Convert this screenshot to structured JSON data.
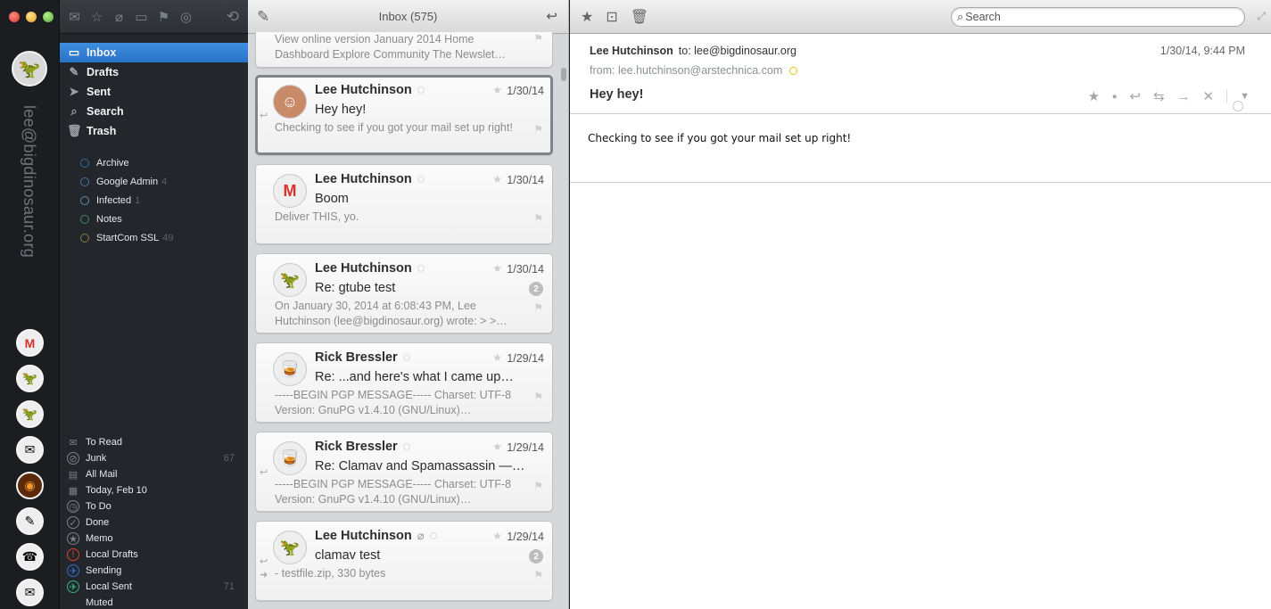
{
  "window": {
    "traffic_lights": [
      "close",
      "minimize",
      "zoom"
    ]
  },
  "rail": {
    "account_email": "lee@bigdinosaur.org",
    "avatars": [
      {
        "name": "gmail-avatar",
        "glyph": "M"
      },
      {
        "name": "dinosaur-avatar",
        "glyph": "🦖"
      },
      {
        "name": "dinosaur-avatar-2",
        "glyph": "🦖"
      },
      {
        "name": "envelope-avatar",
        "glyph": "✉"
      },
      {
        "name": "swirl-avatar",
        "glyph": "◉"
      },
      {
        "name": "admin-avatar",
        "glyph": "✎"
      },
      {
        "name": "webmaster-avatar",
        "glyph": "☎"
      },
      {
        "name": "envelope-avatar-2",
        "glyph": "✉"
      }
    ]
  },
  "sidebar": {
    "toolbar_icons": [
      "mail-icon",
      "star-icon",
      "paperclip-icon",
      "speech-icon",
      "flag-icon",
      "target-icon"
    ],
    "folders": [
      {
        "label": "Inbox",
        "icon": "tray-icon",
        "glyph": "▭",
        "active": true
      },
      {
        "label": "Drafts",
        "icon": "pencil-icon",
        "glyph": "✎",
        "active": false
      },
      {
        "label": "Sent",
        "icon": "paper-plane-icon",
        "glyph": "➤",
        "active": false
      },
      {
        "label": "Search",
        "icon": "search-icon",
        "glyph": "⌕",
        "active": false
      },
      {
        "label": "Trash",
        "icon": "trash-icon",
        "glyph": "🗑",
        "active": false
      }
    ],
    "labels": [
      {
        "label": "Archive",
        "count": "",
        "color": "#2a6fa8"
      },
      {
        "label": "Google Admin",
        "count": "4",
        "color": "#3d7aa0"
      },
      {
        "label": "Infected",
        "count": "1",
        "color": "#5e8fa8"
      },
      {
        "label": "Notes",
        "count": "",
        "color": "#3d8a5c"
      },
      {
        "label": "StartCom SSL",
        "count": "49",
        "color": "#8a7d40"
      }
    ],
    "smart_folders": [
      {
        "label": "To Read",
        "count": "",
        "icon": "envelope-icon",
        "glyph": "✉",
        "color": "#7c8189"
      },
      {
        "label": "Junk",
        "count": "67",
        "icon": "prohibited-icon",
        "glyph": "⊘",
        "color": "#7c8189"
      },
      {
        "label": "All Mail",
        "count": "",
        "icon": "archive-box-icon",
        "glyph": "▤",
        "color": "#7c8189"
      },
      {
        "label": "Today, Feb 10",
        "count": "",
        "icon": "book-icon",
        "glyph": "▦",
        "color": "#7c8189"
      },
      {
        "label": "To Do",
        "count": "",
        "icon": "clock-icon",
        "glyph": "◷",
        "color": "#7c8189"
      },
      {
        "label": "Done",
        "count": "",
        "icon": "checkmark-icon",
        "glyph": "✓",
        "color": "#7c8189"
      },
      {
        "label": "Memo",
        "count": "",
        "icon": "star-circle-icon",
        "glyph": "★",
        "color": "#7c8189"
      },
      {
        "label": "Local Drafts",
        "count": "",
        "icon": "warning-icon",
        "glyph": "!",
        "color": "#d9432e"
      },
      {
        "label": "Sending",
        "count": "",
        "icon": "plane-circle-icon",
        "glyph": "✈",
        "color": "#2d6fd0"
      },
      {
        "label": "Local Sent",
        "count": "71",
        "icon": "sent-circle-icon",
        "glyph": "✈",
        "color": "#2fb37a"
      },
      {
        "label": "Muted",
        "count": "",
        "icon": "",
        "glyph": "",
        "color": "#7c8189"
      }
    ]
  },
  "list": {
    "title": "Inbox (575)",
    "partial_preview": "View online version January 2014 Home Dashboard Explore Community The Newslet…",
    "messages": [
      {
        "from": "Lee Hutchinson",
        "subject": "Hey hey!",
        "date": "1/30/14",
        "preview": "Checking to see if you got your mail set up right!",
        "avatar": "person-photo",
        "glyph": "☺",
        "badge": "",
        "selected": true,
        "replied": true,
        "forwarded": false,
        "attachment": false
      },
      {
        "from": "Lee Hutchinson",
        "subject": "Boom",
        "date": "1/30/14",
        "preview": "Deliver THIS, yo.",
        "avatar": "gmail-logo",
        "glyph": "M",
        "badge": "",
        "selected": false,
        "replied": false,
        "forwarded": false,
        "attachment": false
      },
      {
        "from": "Lee Hutchinson",
        "subject": "Re: gtube test",
        "date": "1/30/14",
        "preview": "On January 30, 2014 at 6:08:43 PM, Lee Hutchinson (lee@bigdinosaur.org) wrote: > >…",
        "avatar": "dinosaur-logo",
        "glyph": "🦖",
        "badge": "2",
        "selected": false,
        "replied": false,
        "forwarded": false,
        "attachment": false
      },
      {
        "from": "Rick Bressler",
        "subject": "Re: ...and here's what I came up…",
        "date": "1/29/14",
        "preview": "-----BEGIN PGP MESSAGE----- Charset: UTF-8 Version: GnuPG v1.4.10 (GNU/Linux)…",
        "avatar": "whisky-glass",
        "glyph": "🥃",
        "badge": "",
        "selected": false,
        "replied": false,
        "forwarded": false,
        "attachment": false
      },
      {
        "from": "Rick Bressler",
        "subject": "Re: Clamav and Spamassassin —…",
        "date": "1/29/14",
        "preview": "-----BEGIN PGP MESSAGE----- Charset: UTF-8 Version: GnuPG v1.4.10 (GNU/Linux)…",
        "avatar": "whisky-glass",
        "glyph": "🥃",
        "badge": "",
        "selected": false,
        "replied": true,
        "forwarded": false,
        "attachment": false
      },
      {
        "from": "Lee Hutchinson",
        "subject": "clamav test",
        "date": "1/29/14",
        "preview": "- testfile.zip, 330 bytes",
        "avatar": "dinosaur-logo",
        "glyph": "🦖",
        "badge": "2",
        "selected": false,
        "replied": true,
        "forwarded": true,
        "attachment": true
      }
    ]
  },
  "reader": {
    "search_placeholder": "Search",
    "from_name": "Lee Hutchinson",
    "to": "to: lee@bigdinosaur.org",
    "from_addr": "from: lee.hutchinson@arstechnica.com",
    "subject": "Hey hey!",
    "date": "1/30/14, 9:44 PM",
    "body": "Checking to see if you got your mail set up right!"
  }
}
